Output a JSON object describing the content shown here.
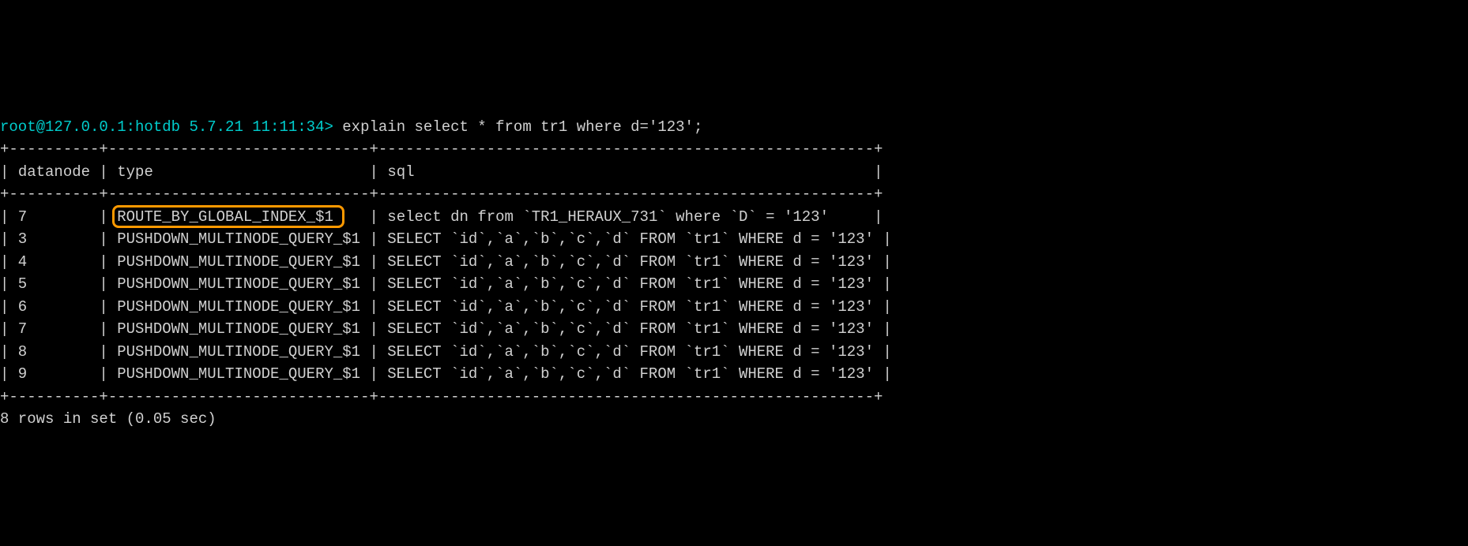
{
  "prompt": {
    "user_host": "root@127.0.0.1:hotdb 5.7.21 11:11:34>",
    "command": " explain select * from tr1 where d='123';"
  },
  "headers": {
    "datanode": "datanode",
    "type": "type",
    "sql": "sql"
  },
  "rows": [
    {
      "datanode": "7",
      "type": "ROUTE_BY_GLOBAL_INDEX_$1",
      "sql": "select dn from `TR1_HERAUX_731` where `D` = '123'",
      "highlighted": true
    },
    {
      "datanode": "3",
      "type": "PUSHDOWN_MULTINODE_QUERY_$1",
      "sql": "SELECT `id`,`a`,`b`,`c`,`d` FROM `tr1` WHERE d = '123'"
    },
    {
      "datanode": "4",
      "type": "PUSHDOWN_MULTINODE_QUERY_$1",
      "sql": "SELECT `id`,`a`,`b`,`c`,`d` FROM `tr1` WHERE d = '123'"
    },
    {
      "datanode": "5",
      "type": "PUSHDOWN_MULTINODE_QUERY_$1",
      "sql": "SELECT `id`,`a`,`b`,`c`,`d` FROM `tr1` WHERE d = '123'"
    },
    {
      "datanode": "6",
      "type": "PUSHDOWN_MULTINODE_QUERY_$1",
      "sql": "SELECT `id`,`a`,`b`,`c`,`d` FROM `tr1` WHERE d = '123'"
    },
    {
      "datanode": "7",
      "type": "PUSHDOWN_MULTINODE_QUERY_$1",
      "sql": "SELECT `id`,`a`,`b`,`c`,`d` FROM `tr1` WHERE d = '123'"
    },
    {
      "datanode": "8",
      "type": "PUSHDOWN_MULTINODE_QUERY_$1",
      "sql": "SELECT `id`,`a`,`b`,`c`,`d` FROM `tr1` WHERE d = '123'"
    },
    {
      "datanode": "9",
      "type": "PUSHDOWN_MULTINODE_QUERY_$1",
      "sql": "SELECT `id`,`a`,`b`,`c`,`d` FROM `tr1` WHERE d = '123'"
    }
  ],
  "separator": "+----------+-----------------------------+-------------------------------------------------------+",
  "footer": "8 rows in set (0.05 sec)",
  "col_widths": {
    "datanode": 8,
    "type": 27,
    "sql": 53
  }
}
